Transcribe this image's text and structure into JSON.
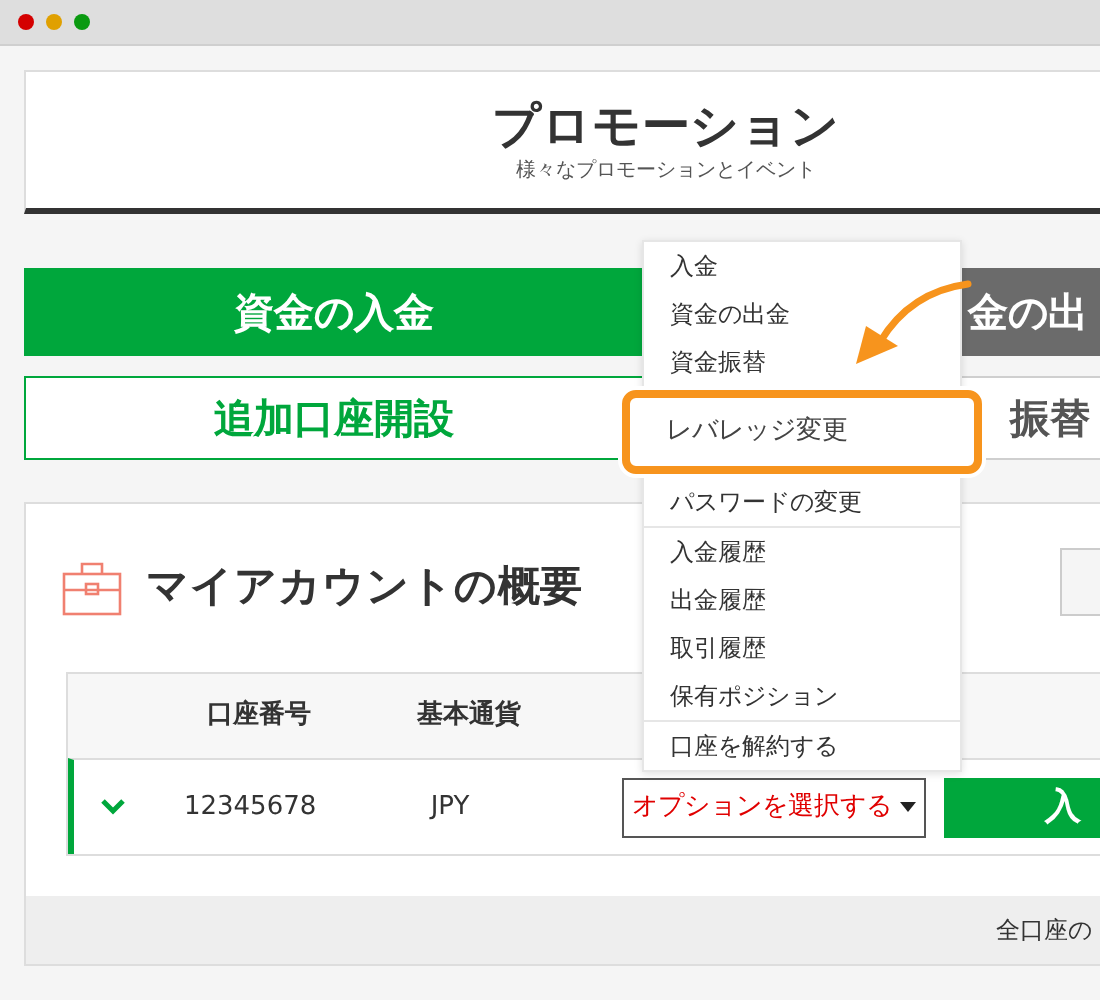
{
  "header": {
    "title": "プロモーション",
    "subtitle": "様々なプロモーションとイベント"
  },
  "actions": [
    {
      "label": "資金の入金",
      "kind": "primary"
    },
    {
      "label": "金の出",
      "kind": "dark"
    },
    {
      "label": "追加口座開設",
      "kind": "outline"
    },
    {
      "label": "振替",
      "kind": "outline-gray"
    }
  ],
  "account": {
    "title": "マイアカウントの概要",
    "columns": [
      "口座番号",
      "基本通貨"
    ],
    "rows": [
      {
        "expanded": true,
        "number": "12345678",
        "currency": "JPY",
        "select": "オプションを選択する",
        "button": "入"
      }
    ],
    "footer": "全口座の"
  },
  "menu": {
    "sections": [
      {
        "items": [
          {
            "label": "入金",
            "selected": false
          },
          {
            "label": "資金の出金",
            "selected": false
          },
          {
            "label": "資金振替",
            "selected": false
          },
          {
            "label": "レバレッジ変更",
            "selected": true
          },
          {
            "label": "パスワードの変更",
            "selected": false
          }
        ]
      },
      {
        "items": [
          {
            "label": "入金履歴",
            "selected": false
          },
          {
            "label": "出金履歴",
            "selected": false
          },
          {
            "label": "取引履歴",
            "selected": false
          },
          {
            "label": "保有ポジション",
            "selected": false
          }
        ]
      },
      {
        "items": [
          {
            "label": "口座を解約する",
            "selected": false
          }
        ]
      }
    ]
  }
}
